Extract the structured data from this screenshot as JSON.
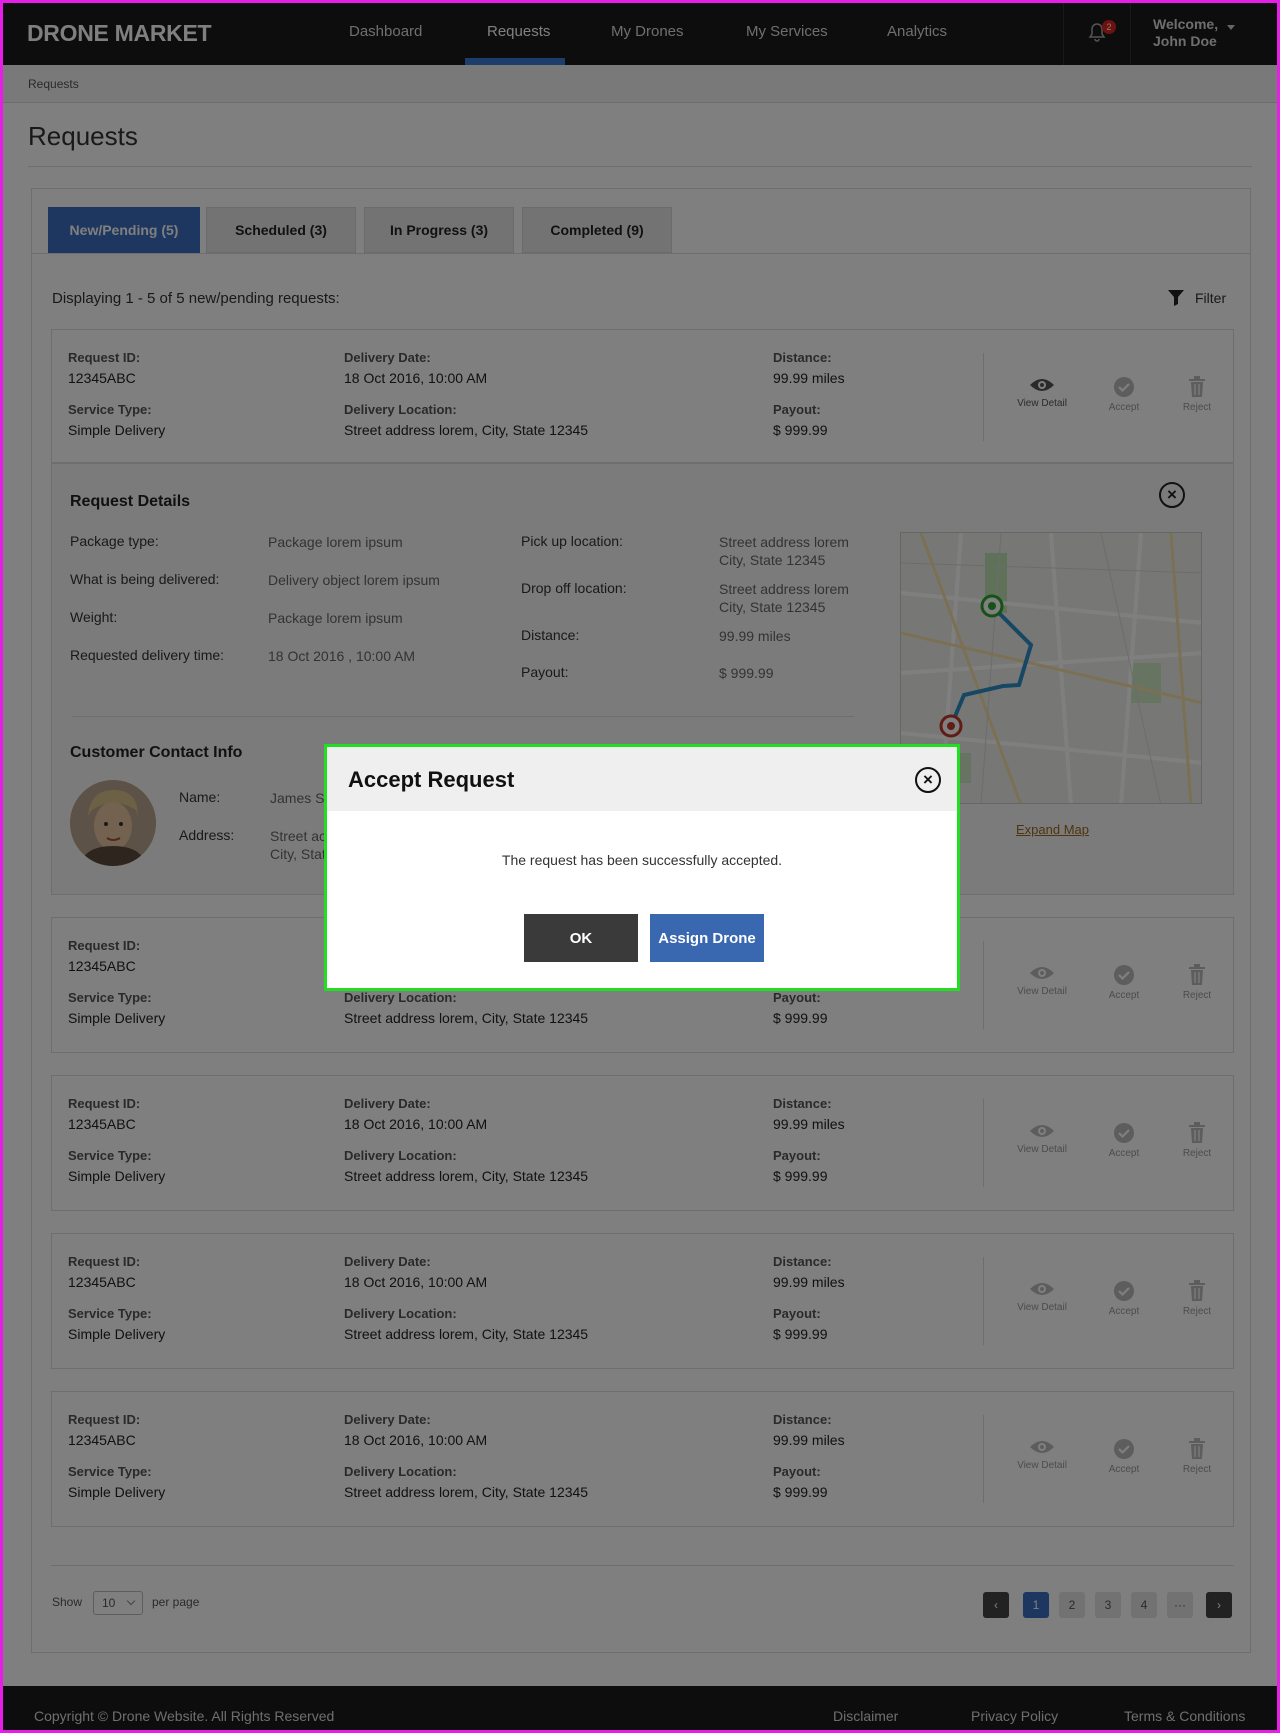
{
  "header": {
    "logo": "DRONE MARKET",
    "nav": [
      "Dashboard",
      "Requests",
      "My Drones",
      "My Services",
      "Analytics"
    ],
    "active_nav": "Requests",
    "notification_count": "2",
    "welcome_line1": "Welcome,",
    "welcome_line2": "John Doe"
  },
  "breadcrumb": "Requests",
  "page_title": "Requests",
  "tabs": [
    "New/Pending (5)",
    "Scheduled (3)",
    "In Progress (3)",
    "Completed (9)"
  ],
  "display_text": "Displaying 1 - 5 of 5 new/pending requests:",
  "filter_label": "Filter",
  "request_labels": {
    "id": "Request ID:",
    "service": "Service Type:",
    "date": "Delivery Date:",
    "location": "Delivery Location:",
    "distance": "Distance:",
    "payout": "Payout:"
  },
  "request": {
    "id": "12345ABC",
    "service": "Simple Delivery",
    "date": "18 Oct 2016, 10:00 AM",
    "location": "Street address lorem, City, State 12345",
    "distance": "99.99 miles",
    "payout": "$ 999.99"
  },
  "actions": {
    "view": "View Detail",
    "accept": "Accept",
    "reject": "Reject"
  },
  "details": {
    "title": "Request Details",
    "package_type_label": "Package type:",
    "package_type": "Package lorem ipsum",
    "delivered_label": "What is being delivered:",
    "delivered": "Delivery object lorem ipsum",
    "weight_label": "Weight:",
    "weight": "Package lorem ipsum",
    "time_label": "Requested delivery time:",
    "time": "18 Oct 2016 , 10:00 AM",
    "pickup_label": "Pick up location:",
    "pickup_1": "Street address lorem",
    "pickup_2": "City, State 12345",
    "dropoff_label": "Drop off location:",
    "dropoff_1": "Street address lorem",
    "dropoff_2": "City, State 12345",
    "distance_label": "Distance:",
    "distance": "99.99 miles",
    "payout_label": "Payout:",
    "payout": "$ 999.99",
    "expand_map": "Expand Map",
    "contact_title": "Customer Contact Info",
    "name_label": "Name:",
    "name": "James S",
    "address_label": "Address:",
    "address_1": "Street ac",
    "address_2": "City, Stat"
  },
  "pagination": {
    "show": "Show",
    "per_page_value": "10",
    "per_page": "per page",
    "pages": [
      "1",
      "2",
      "3",
      "4",
      "···"
    ],
    "current": "1"
  },
  "footer": {
    "copyright": "Copyright © Drone Website. All Rights Reserved",
    "links": [
      "Disclaimer",
      "Privacy Policy",
      "Terms & Conditions"
    ]
  },
  "modal": {
    "title": "Accept Request",
    "message": "The request has been successfully accepted.",
    "ok": "OK",
    "assign": "Assign Drone"
  },
  "colors": {
    "primary": "#3a6fc0",
    "modal_border": "#22dd22",
    "frame_border": "#e61ee6",
    "header_bg": "#1b1b1b"
  }
}
